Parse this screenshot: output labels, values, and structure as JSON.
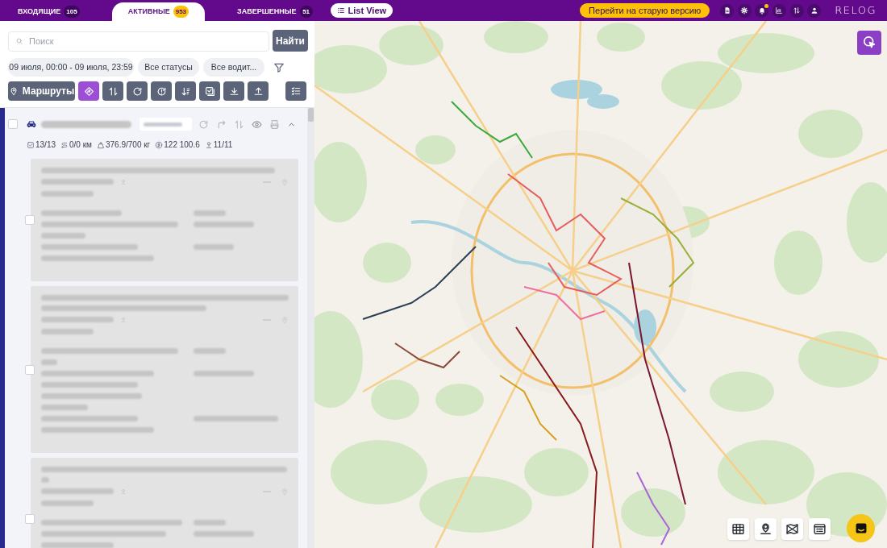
{
  "header": {
    "tabs": [
      {
        "label": "ВХОДЯЩИЕ",
        "count": "105",
        "selected": false
      },
      {
        "label": "АКТИВНЫЕ",
        "count": "953",
        "selected": true
      },
      {
        "label": "ЗАВЕРШЕННЫЕ",
        "count": "51",
        "selected": false
      }
    ],
    "view_button": "List View",
    "old_version_button": "Перейти на старую версию",
    "notifications_unread": true,
    "logo": "RELOG"
  },
  "search": {
    "placeholder": "Поиск",
    "button": "Найти"
  },
  "filters": [
    "09 июля, 00:00 - 09 июля, 23:59",
    "Все статусы",
    "Все водит..."
  ],
  "toolbar": {
    "routes_button": "Маршруты",
    "tools": [
      {
        "active": true
      },
      {
        "active": false
      },
      {
        "active": false
      },
      {
        "active": false
      },
      {
        "active": false
      },
      {
        "active": false
      },
      {
        "active": false
      },
      {
        "active": false
      }
    ]
  },
  "route": {
    "checked": false,
    "stats": [
      "13/13",
      "0/0 км",
      "376.9/700 кг",
      "122 100.6",
      "11/11"
    ]
  },
  "orders": [
    {
      "checked": false
    },
    {
      "checked": false
    },
    {
      "checked": false
    }
  ]
}
